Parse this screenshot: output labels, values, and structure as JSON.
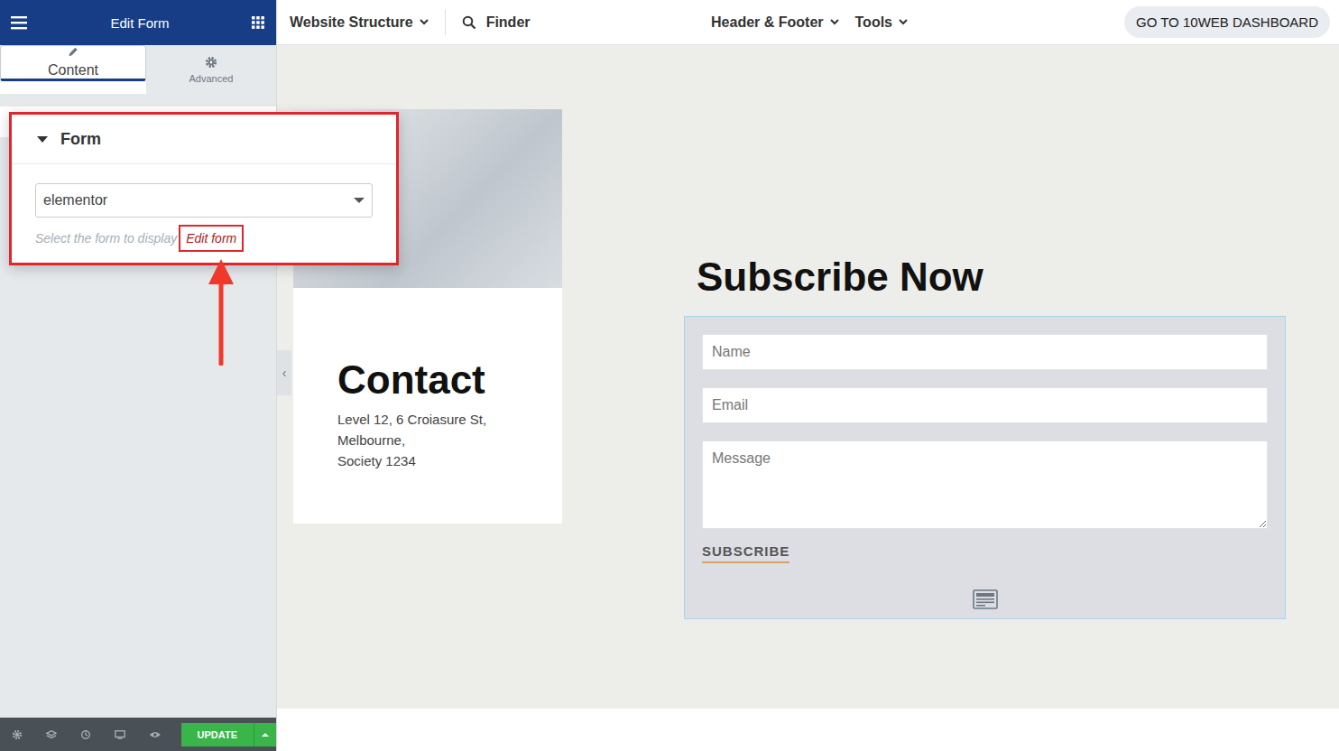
{
  "panel": {
    "title": "Edit Form",
    "tabs": [
      {
        "label": "Content",
        "selected": true
      },
      {
        "label": "Advanced",
        "selected": false
      }
    ],
    "section": {
      "title": "Form",
      "expanded": true,
      "select_value": "elementor",
      "help": "Select the form to display",
      "link": "Edit form"
    },
    "update_button": "UPDATE"
  },
  "topbar": {
    "menus": [
      {
        "label": "Website Structure"
      }
    ],
    "finder": "Finder",
    "right_menus": [
      {
        "label": "Header & Footer"
      },
      {
        "label": "Tools"
      }
    ],
    "dashboard_button": "GO TO 10WEB DASHBOARD"
  },
  "canvas": {
    "collapse": "‹",
    "contact": {
      "title": "Contact",
      "address": [
        "Level 12, 6 Croiasure St,",
        "Melbourne,",
        "Society 1234"
      ]
    },
    "subscribe": {
      "title": "Subscribe Now",
      "fields": [
        {
          "placeholder": "Name",
          "kind": "input"
        },
        {
          "placeholder": "Email",
          "kind": "input"
        },
        {
          "placeholder": "Message",
          "kind": "textarea"
        }
      ],
      "submit": "SUBSCRIBE"
    }
  }
}
